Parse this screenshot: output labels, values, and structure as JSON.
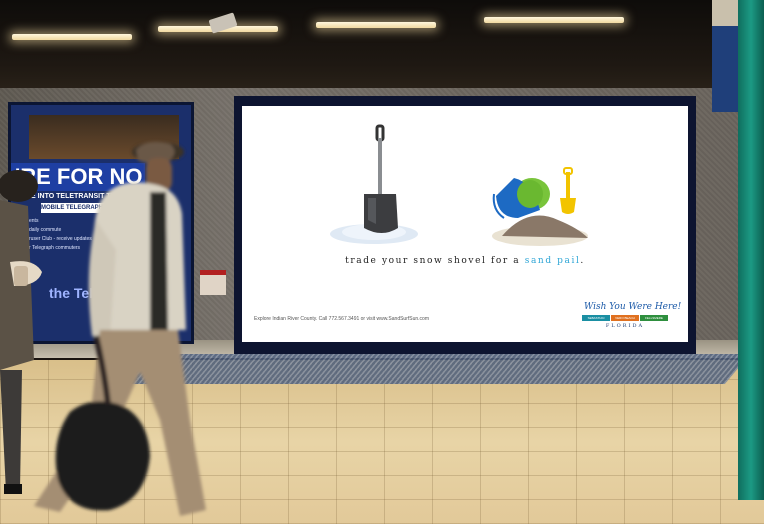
{
  "left_poster": {
    "headline": "'RE FOR NO",
    "line1": "E INTO TELETRANSIT TIME",
    "line2": "MOBILE TELEGRAPH",
    "list": [
      "ents",
      "daily commute",
      "ruser Club - receive updates",
      "r Telegraph commuters"
    ],
    "brand": "the Tele"
  },
  "billboard": {
    "tagline_main": "trade your snow shovel for a ",
    "tagline_accent": "sand pail",
    "tagline_end": ".",
    "contact": "Explore Indian River County. Call 772.567.3491 or visit www.SandSurfSun.com",
    "logo": {
      "script": "Wish You Were Here!",
      "towns": [
        "SEBASTIAN",
        "VERO BEACH",
        "FELLSMERE"
      ],
      "state": "FLORIDA"
    }
  },
  "colors": {
    "accent_blue": "#2fa6d6",
    "logo_green": "#2e8f3e",
    "logo_orange": "#e0701f",
    "logo_teal": "#1a8fa3",
    "pillar_teal": "#1c9a84",
    "frame_navy": "#0d1430"
  }
}
